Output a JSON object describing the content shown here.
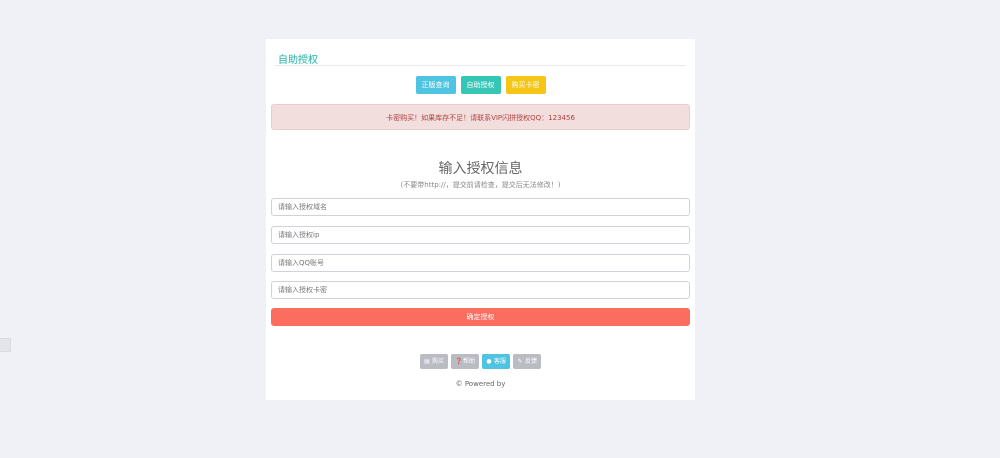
{
  "card": {
    "title": "自助授权"
  },
  "top_buttons": [
    {
      "label": "正版查询",
      "color": "#4fc3e2"
    },
    {
      "label": "自助授权",
      "color": "#36c6b6"
    },
    {
      "label": "购买卡密",
      "color": "#f5c518"
    }
  ],
  "alert": {
    "text": "卡密购买！如果库存不足！请联系VIP闪拼授权QQ：123456"
  },
  "form": {
    "heading": "输入授权信息",
    "subheading": "(不要带http://，提交前请检查，提交后无法修改！)",
    "domain_placeholder": "请输入授权域名",
    "ip_placeholder": "请输入授权ip",
    "qq_placeholder": "请输入QQ账号",
    "card_placeholder": "请输入授权卡密",
    "submit_label": "确定授权"
  },
  "footer_buttons": [
    {
      "label": "购买",
      "icon": "cart-icon"
    },
    {
      "label": "帮助",
      "icon": "help-icon"
    },
    {
      "label": "客服",
      "icon": "user-icon"
    },
    {
      "label": "反馈",
      "icon": "pencil-icon"
    }
  ],
  "footer": {
    "powered_by": "© Powered by"
  },
  "colors": {
    "page_bg": "#f0f1f6",
    "accent_teal": "#22b1a3",
    "submit_red": "#fb6e5f",
    "alert_bg": "#f3dede",
    "alert_text": "#b0413e"
  }
}
